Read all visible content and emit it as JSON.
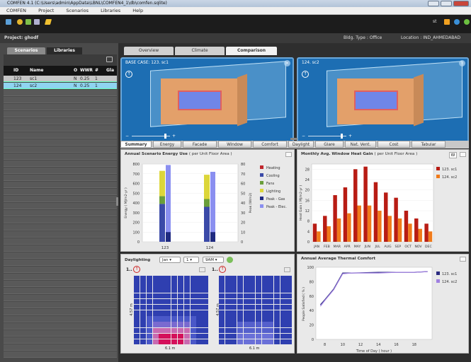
{
  "window": {
    "title": "COMFEN 4.1 (C:\\Users\\admin\\AppData\\LBNL\\COMFEN4_1\\db\\comfen.sqlite)"
  },
  "menu": [
    "COMFEN",
    "Project",
    "Scenarios",
    "Libraries",
    "Help"
  ],
  "toolbar": {
    "user": "st"
  },
  "project": {
    "label": "Project: ghodf",
    "bldg_type": "Bldg. Type :  Office",
    "location": "Location :  IND_AHMEDABAD"
  },
  "left_tabs": {
    "scenarios": "Scenarios",
    "libraries": "Libraries"
  },
  "table": {
    "headers": [
      "ID",
      "Name",
      "O",
      "WWR",
      "#",
      "Gla"
    ],
    "rows": [
      [
        "123",
        "sc1",
        "N",
        "0.25",
        "1",
        ""
      ],
      [
        "124",
        "sc2",
        "N",
        "0.25",
        "1",
        ""
      ]
    ]
  },
  "top_tabs": [
    "Overview",
    "Climate",
    "Comparison"
  ],
  "views": {
    "left_title": "BASE CASE: 123. sc1",
    "right_title": "124. sc2"
  },
  "sub_tabs": [
    "Summary",
    "Energy",
    "Facade",
    "Window",
    "Comfort",
    "Daylight",
    "Glare",
    "Nat. Vent.",
    "Cost",
    "Tabular"
  ],
  "energy_panel": {
    "title": "Annual Scenario Energy Use",
    "subtitle": "( per Unit Floor Area )"
  },
  "heat_panel": {
    "title": "Monthly Avg. Window Heat Gain",
    "subtitle": "( per Unit Floor Area )",
    "w_button": "W"
  },
  "daylight_panel": {
    "title": "Daylighting",
    "month": "Jan",
    "day": "1",
    "time": "9AM",
    "left_label": "1..",
    "right_label": "1..",
    "dim_x": "6.1 m",
    "dim_y": "4.57 m"
  },
  "comfort_panel": {
    "title": "Annual Average Thermal Comfort"
  },
  "chart_data": [
    {
      "type": "bar",
      "title": "Annual Scenario Energy Use ( per Unit Floor Area )",
      "categories": [
        "123",
        "124"
      ],
      "ylabel": "Energy ( MJ/m2-yr )",
      "y2label": "Peak (W/m2)",
      "ylim": [
        0,
        800
      ],
      "y2lim": [
        0,
        80
      ],
      "yticks": [
        0,
        100,
        200,
        300,
        400,
        500,
        600,
        700,
        800
      ],
      "y2ticks": [
        0,
        10,
        20,
        30,
        40,
        50,
        60,
        70,
        80
      ],
      "stacked_series": [
        {
          "name": "Heating",
          "color": "#c0272d",
          "values": [
            0,
            0
          ]
        },
        {
          "name": "Cooling",
          "color": "#3b4aa8",
          "values": [
            390,
            360
          ]
        },
        {
          "name": "Fans",
          "color": "#6a9e3a",
          "values": [
            80,
            80
          ]
        },
        {
          "name": "Lighting",
          "color": "#dcd63a",
          "values": [
            260,
            250
          ]
        }
      ],
      "peak_series": [
        {
          "name": "Peak - Gas",
          "color": "#1f2a80",
          "values": [
            10,
            10
          ]
        },
        {
          "name": "Peak - Elec.",
          "color": "#8a8ff0",
          "values": [
            79,
            72
          ]
        }
      ]
    },
    {
      "type": "bar",
      "title": "Monthly Avg. Window Heat Gain ( per Unit Floor Area )",
      "categories": [
        "JAN",
        "FEB",
        "MAR",
        "APR",
        "MAY",
        "JUN",
        "JUL",
        "AUG",
        "SEP",
        "OCT",
        "NOV",
        "DEC"
      ],
      "ylabel": "Heat Gain ( MJ/m2-yr )",
      "ylim": [
        0,
        30
      ],
      "yticks": [
        0,
        4,
        8,
        12,
        16,
        20,
        24,
        28
      ],
      "series": [
        {
          "name": "123. sc1",
          "color": "#b81c14",
          "values": [
            7,
            10,
            18,
            21,
            28,
            29,
            23,
            19,
            17,
            12,
            9,
            7
          ]
        },
        {
          "name": "124. sc2",
          "color": "#f07a1a",
          "values": [
            4,
            6,
            9,
            11,
            14,
            14,
            12,
            10,
            9,
            7,
            5,
            4
          ]
        }
      ]
    },
    {
      "type": "line",
      "title": "Annual Average Thermal Comfort",
      "xlabel": "Time of Day ( hour )",
      "ylabel": "People Satisfied ( % )",
      "xlim": [
        7,
        20
      ],
      "ylim": [
        0,
        100
      ],
      "xticks": [
        8,
        10,
        12,
        14,
        16,
        18
      ],
      "yticks": [
        0,
        20,
        40,
        60,
        80,
        100
      ],
      "series": [
        {
          "name": "123. sc1",
          "color": "#2c2c80",
          "x": [
            7.5,
            8,
            9,
            10,
            11,
            14,
            16,
            18,
            19.5
          ],
          "y": [
            48,
            55,
            70,
            92,
            92,
            93,
            93,
            93,
            94
          ]
        },
        {
          "name": "124. sc2",
          "color": "#a080e0",
          "x": [
            7.5,
            8,
            9,
            10,
            11,
            14,
            16,
            18,
            19.5
          ],
          "y": [
            46,
            54,
            69,
            91,
            92,
            92,
            93,
            93,
            94
          ]
        }
      ]
    }
  ],
  "colors": {
    "accent": "#1d6eb3",
    "selected_row": "#8fd4f0"
  }
}
